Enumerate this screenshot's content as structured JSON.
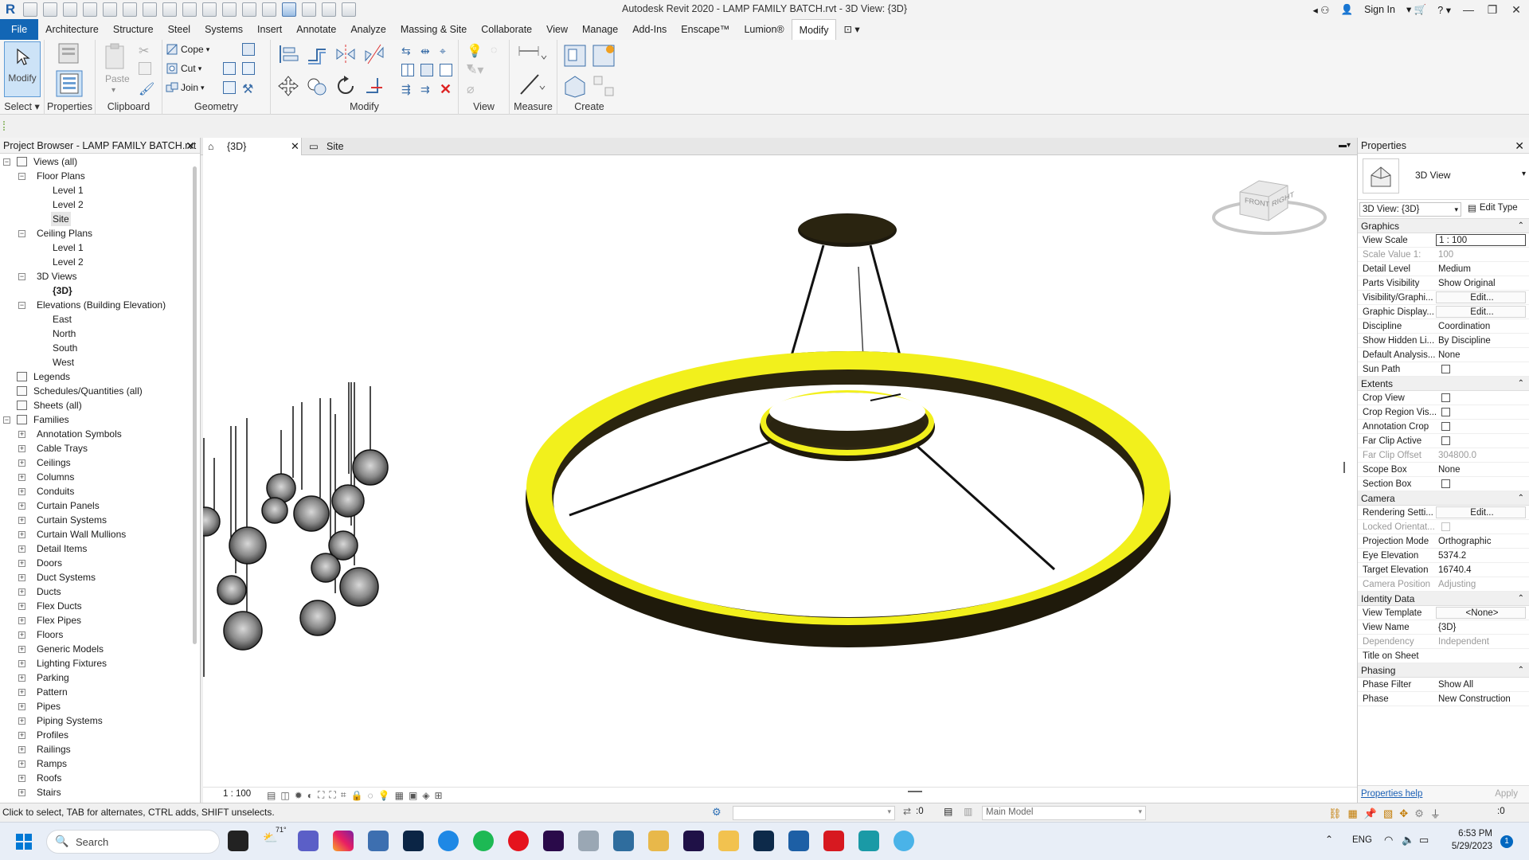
{
  "app": {
    "title": "Autodesk Revit 2020 - LAMP FAMILY BATCH.rvt - 3D View: {3D}",
    "sign_in": "Sign In"
  },
  "menu": [
    "File",
    "Architecture",
    "Structure",
    "Steel",
    "Systems",
    "Insert",
    "Annotate",
    "Analyze",
    "Massing & Site",
    "Collaborate",
    "View",
    "Manage",
    "Add-Ins",
    "Enscape™",
    "Lumion®",
    "Modify"
  ],
  "ribbon": {
    "panels": {
      "select": "Select",
      "properties": "Properties",
      "clipboard": "Clipboard",
      "geometry": "Geometry",
      "modify": "Modify",
      "view": "View",
      "measure": "Measure",
      "create": "Create"
    },
    "modify_label": "Modify",
    "properties_label": "Properties",
    "paste_label": "Paste",
    "cope_label": "Cope",
    "cut_label": "Cut",
    "join_label": "Join"
  },
  "project_browser": {
    "title": "Project Browser - LAMP FAMILY BATCH.rvt",
    "tree": [
      {
        "label": "Views (all)",
        "level": 0,
        "exp": "-",
        "icon": "views"
      },
      {
        "label": "Floor Plans",
        "level": 1,
        "exp": "-"
      },
      {
        "label": "Level 1",
        "level": 2
      },
      {
        "label": "Level 2",
        "level": 2
      },
      {
        "label": "Site",
        "level": 2,
        "selected": true
      },
      {
        "label": "Ceiling Plans",
        "level": 1,
        "exp": "-"
      },
      {
        "label": "Level 1",
        "level": 2
      },
      {
        "label": "Level 2",
        "level": 2
      },
      {
        "label": "3D Views",
        "level": 1,
        "exp": "-"
      },
      {
        "label": "{3D}",
        "level": 2,
        "bold": true
      },
      {
        "label": "Elevations (Building Elevation)",
        "level": 1,
        "exp": "-"
      },
      {
        "label": "East",
        "level": 2
      },
      {
        "label": "North",
        "level": 2
      },
      {
        "label": "South",
        "level": 2
      },
      {
        "label": "West",
        "level": 2
      },
      {
        "label": "Legends",
        "level": 0,
        "icon": "legend"
      },
      {
        "label": "Schedules/Quantities (all)",
        "level": 0,
        "icon": "schedule"
      },
      {
        "label": "Sheets (all)",
        "level": 0,
        "icon": "sheet"
      },
      {
        "label": "Families",
        "level": 0,
        "exp": "-",
        "icon": "family"
      },
      {
        "label": "Annotation Symbols",
        "level": 1,
        "exp": "+"
      },
      {
        "label": "Cable Trays",
        "level": 1,
        "exp": "+"
      },
      {
        "label": "Ceilings",
        "level": 1,
        "exp": "+"
      },
      {
        "label": "Columns",
        "level": 1,
        "exp": "+"
      },
      {
        "label": "Conduits",
        "level": 1,
        "exp": "+"
      },
      {
        "label": "Curtain Panels",
        "level": 1,
        "exp": "+"
      },
      {
        "label": "Curtain Systems",
        "level": 1,
        "exp": "+"
      },
      {
        "label": "Curtain Wall Mullions",
        "level": 1,
        "exp": "+"
      },
      {
        "label": "Detail Items",
        "level": 1,
        "exp": "+"
      },
      {
        "label": "Doors",
        "level": 1,
        "exp": "+"
      },
      {
        "label": "Duct Systems",
        "level": 1,
        "exp": "+"
      },
      {
        "label": "Ducts",
        "level": 1,
        "exp": "+"
      },
      {
        "label": "Flex Ducts",
        "level": 1,
        "exp": "+"
      },
      {
        "label": "Flex Pipes",
        "level": 1,
        "exp": "+"
      },
      {
        "label": "Floors",
        "level": 1,
        "exp": "+"
      },
      {
        "label": "Generic Models",
        "level": 1,
        "exp": "+"
      },
      {
        "label": "Lighting Fixtures",
        "level": 1,
        "exp": "+"
      },
      {
        "label": "Parking",
        "level": 1,
        "exp": "+"
      },
      {
        "label": "Pattern",
        "level": 1,
        "exp": "+"
      },
      {
        "label": "Pipes",
        "level": 1,
        "exp": "+"
      },
      {
        "label": "Piping Systems",
        "level": 1,
        "exp": "+"
      },
      {
        "label": "Profiles",
        "level": 1,
        "exp": "+"
      },
      {
        "label": "Railings",
        "level": 1,
        "exp": "+"
      },
      {
        "label": "Ramps",
        "level": 1,
        "exp": "+"
      },
      {
        "label": "Roofs",
        "level": 1,
        "exp": "+"
      },
      {
        "label": "Stairs",
        "level": 1,
        "exp": "+"
      }
    ]
  },
  "view_tabs": [
    {
      "label": "{3D}",
      "active": true
    },
    {
      "label": "Site",
      "active": false
    }
  ],
  "viewcube": {
    "front": "FRONT",
    "right": "RIGHT"
  },
  "view_scale_bar": "1 : 100",
  "properties": {
    "title": "Properties",
    "type_name": "3D View",
    "instance_selector": "3D View: {3D}",
    "edit_type": "Edit Type",
    "groups": [
      {
        "name": "Graphics",
        "rows": [
          {
            "k": "View Scale",
            "v": "1 : 100",
            "style": "boxed"
          },
          {
            "k": "Scale Value    1:",
            "v": "100",
            "dim": true
          },
          {
            "k": "Detail Level",
            "v": "Medium"
          },
          {
            "k": "Parts Visibility",
            "v": "Show Original"
          },
          {
            "k": "Visibility/Graphi...",
            "v": "Edit...",
            "style": "btn"
          },
          {
            "k": "Graphic Display...",
            "v": "Edit...",
            "style": "btn"
          },
          {
            "k": "Discipline",
            "v": "Coordination"
          },
          {
            "k": "Show Hidden Li...",
            "v": "By Discipline"
          },
          {
            "k": "Default Analysis...",
            "v": "None"
          },
          {
            "k": "Sun Path",
            "v": "",
            "style": "cb"
          }
        ]
      },
      {
        "name": "Extents",
        "rows": [
          {
            "k": "Crop View",
            "v": "",
            "style": "cb"
          },
          {
            "k": "Crop Region Vis...",
            "v": "",
            "style": "cb"
          },
          {
            "k": "Annotation Crop",
            "v": "",
            "style": "cb"
          },
          {
            "k": "Far Clip Active",
            "v": "",
            "style": "cb"
          },
          {
            "k": "Far Clip Offset",
            "v": "304800.0",
            "dim": true
          },
          {
            "k": "Scope Box",
            "v": "None"
          },
          {
            "k": "Section Box",
            "v": "",
            "style": "cb"
          }
        ]
      },
      {
        "name": "Camera",
        "rows": [
          {
            "k": "Rendering Setti...",
            "v": "Edit...",
            "style": "btn"
          },
          {
            "k": "Locked Orientat...",
            "v": "",
            "style": "cb",
            "dim": true
          },
          {
            "k": "Projection Mode",
            "v": "Orthographic"
          },
          {
            "k": "Eye Elevation",
            "v": "5374.2"
          },
          {
            "k": "Target Elevation",
            "v": "16740.4"
          },
          {
            "k": "Camera Position",
            "v": "Adjusting",
            "dim": true
          }
        ]
      },
      {
        "name": "Identity Data",
        "rows": [
          {
            "k": "View Template",
            "v": "<None>",
            "style": "btn"
          },
          {
            "k": "View Name",
            "v": "{3D}"
          },
          {
            "k": "Dependency",
            "v": "Independent",
            "dim": true
          },
          {
            "k": "Title on Sheet",
            "v": ""
          }
        ]
      },
      {
        "name": "Phasing",
        "rows": [
          {
            "k": "Phase Filter",
            "v": "Show All"
          },
          {
            "k": "Phase",
            "v": "New Construction"
          }
        ]
      }
    ],
    "help_link": "Properties help",
    "apply_button": "Apply"
  },
  "status": {
    "hint": "Click to select, TAB for alternates, CTRL adds, SHIFT unselects.",
    "workset_count": ":0",
    "model": "Main Model",
    "filter_count": ":0"
  },
  "taskbar": {
    "search_placeholder": "Search",
    "weather": "71°",
    "lang": "ENG",
    "time": "6:53 PM",
    "date": "5/29/2023",
    "notifications": "1"
  },
  "colors": {
    "accent": "#1266b5",
    "lamp_glow": "#f5f51a",
    "lamp_dark": "#2a2410"
  }
}
